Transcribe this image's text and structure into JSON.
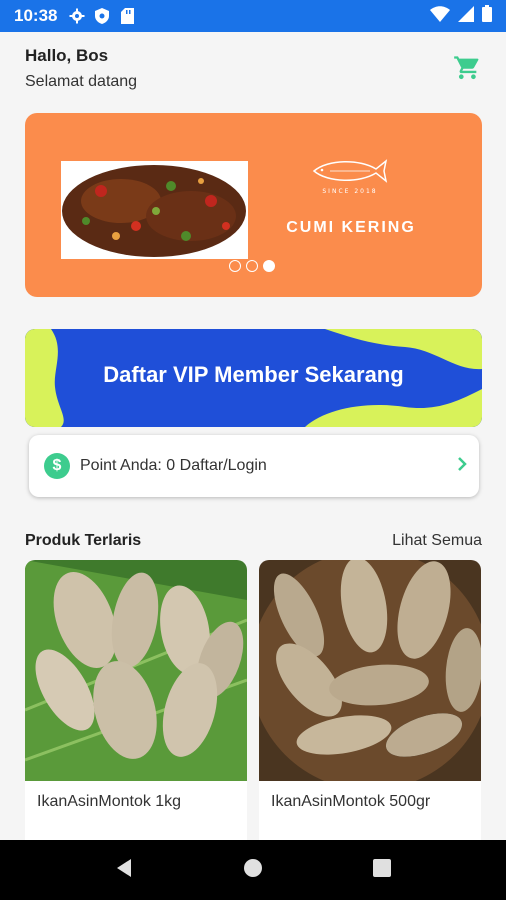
{
  "status_bar": {
    "time": "10:38"
  },
  "header": {
    "greeting": "Hallo, Bos",
    "subtitle": "Selamat datang"
  },
  "banner": {
    "title": "CUMI KERING",
    "logo_text": "SINCE 2018",
    "slide_count": 3,
    "active_slide": 3
  },
  "vip_banner": {
    "text": "Daftar VIP Member Sekarang"
  },
  "points": {
    "text": "Point Anda: 0 Daftar/Login",
    "icon_glyph": "$"
  },
  "section": {
    "title": "Produk Terlaris",
    "see_all": "Lihat Semua"
  },
  "products": [
    {
      "name": "IkanAsinMontok 1kg"
    },
    {
      "name": "IkanAsinMontok 500gr"
    }
  ],
  "colors": {
    "status_bar": "#1a73e8",
    "accent": "#3dcc8e",
    "banner": "#fb8c4c",
    "vip_blue": "#1f4fd8",
    "vip_yellow": "#d8f25a"
  }
}
